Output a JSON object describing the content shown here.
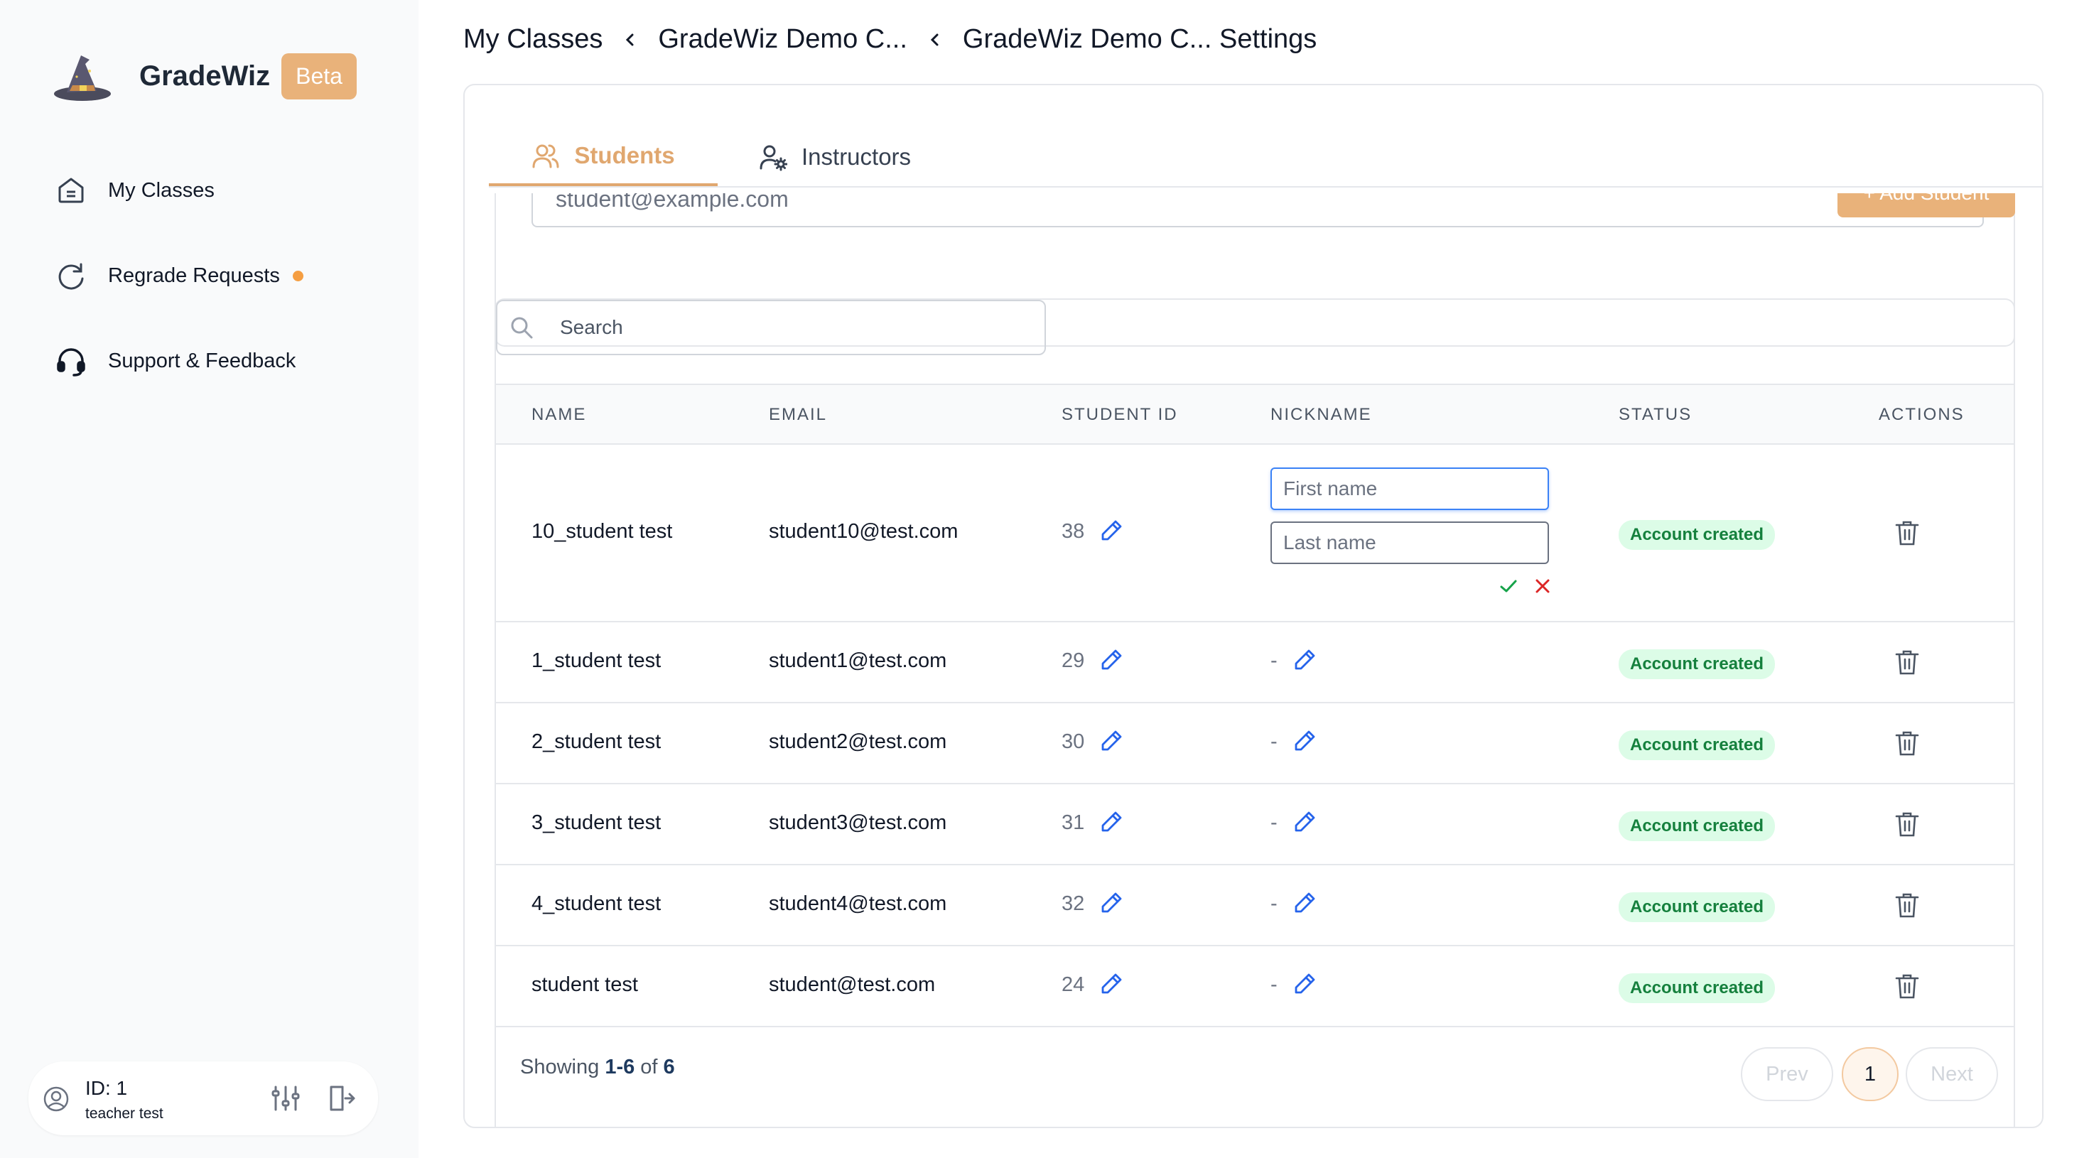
{
  "sidebar": {
    "brand": "GradeWiz",
    "beta": "Beta",
    "nav": [
      {
        "label": "My Classes",
        "icon": "home-icon"
      },
      {
        "label": "Regrade Requests",
        "icon": "refresh-icon",
        "notification_dot": true
      },
      {
        "label": "Support & Feedback",
        "icon": "headset-icon"
      }
    ],
    "user": {
      "id": "ID: 1",
      "name": "teacher test"
    }
  },
  "breadcrumb": [
    "My Classes",
    "GradeWiz Demo C...",
    "GradeWiz Demo C... Settings"
  ],
  "tabs": {
    "students": "Students",
    "instructors": "Instructors",
    "active": "students"
  },
  "add_student": {
    "placeholder": "student@example.com",
    "button": "+ Add Student"
  },
  "search": {
    "placeholder": "Search"
  },
  "table": {
    "headers": [
      "NAME",
      "EMAIL",
      "STUDENT ID",
      "NICKNAME",
      "STATUS",
      "ACTIONS"
    ],
    "editing": {
      "first_placeholder": "First name",
      "last_placeholder": "Last name"
    },
    "rows": [
      {
        "name": "10_student test",
        "email": "student10@test.com",
        "id": "38",
        "nickname": "",
        "status": "Account created"
      },
      {
        "name": "1_student test",
        "email": "student1@test.com",
        "id": "29",
        "nickname": "-",
        "status": "Account created"
      },
      {
        "name": "2_student test",
        "email": "student2@test.com",
        "id": "30",
        "nickname": "-",
        "status": "Account created"
      },
      {
        "name": "3_student test",
        "email": "student3@test.com",
        "id": "31",
        "nickname": "-",
        "status": "Account created"
      },
      {
        "name": "4_student test",
        "email": "student4@test.com",
        "id": "32",
        "nickname": "-",
        "status": "Account created"
      },
      {
        "name": "student test",
        "email": "student@test.com",
        "id": "24",
        "nickname": "-",
        "status": "Account created"
      }
    ]
  },
  "pagination": {
    "showing_prefix": "Showing ",
    "range": "1-6",
    "of": " of ",
    "total": "6",
    "prev": "Prev",
    "current": "1",
    "next": "Next"
  },
  "colors": {
    "accent": "#e0a76f",
    "badge_bg": "#dcfce7",
    "badge_text": "#15803d",
    "pencil": "#2563eb",
    "check": "#16a34a",
    "cross": "#dc2626"
  }
}
